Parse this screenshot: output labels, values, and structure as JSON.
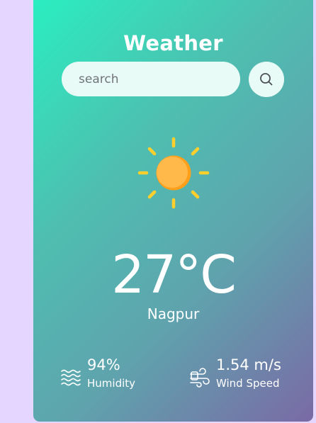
{
  "app": {
    "title": "Weather"
  },
  "search": {
    "placeholder": "search",
    "value": ""
  },
  "icons": {
    "search": "search-icon",
    "weather": "sun-icon",
    "humidity": "humidity-icon",
    "wind": "wind-icon"
  },
  "weather": {
    "temperature": "27°C",
    "city": "Nagpur",
    "humidity": {
      "value": "94%",
      "label": "Humidity"
    },
    "wind": {
      "value": "1.54 m/s",
      "label": "Wind Speed"
    }
  },
  "colors": {
    "background": "#e4d6ff",
    "card_gradient_start": "#2aeec0",
    "card_gradient_end": "#7a6aa6",
    "input_background": "#e9fbf7",
    "sun_body": "#ffb03b",
    "sun_rays": "#ffd02b"
  }
}
